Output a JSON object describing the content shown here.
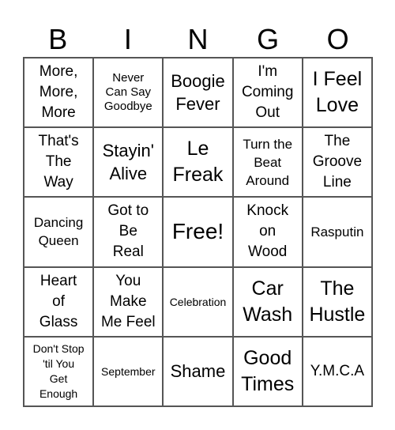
{
  "title_letters": [
    "B",
    "I",
    "N",
    "G",
    "O"
  ],
  "cells": [
    [
      "More,\nMore,\nMore",
      "Never\nCan Say\nGoodbye",
      "Boogie\nFever",
      "I'm\nComing\nOut",
      "I Feel\nLove"
    ],
    [
      "That's\nThe\nWay",
      "Stayin'\nAlive",
      "Le\nFreak",
      "Turn the\nBeat\nAround",
      "The\nGroove\nLine"
    ],
    [
      "Dancing\nQueen",
      "Got to\nBe\nReal",
      "Free!",
      "Knock\non\nWood",
      "Rasputin"
    ],
    [
      "Heart\nof\nGlass",
      "You\nMake\nMe Feel",
      "Celebration",
      "Car\nWash",
      "The\nHustle"
    ],
    [
      "Don't Stop\n'til You\nGet\nEnough",
      "September",
      "Shame",
      "Good\nTimes",
      "Y.M.C.A"
    ]
  ]
}
